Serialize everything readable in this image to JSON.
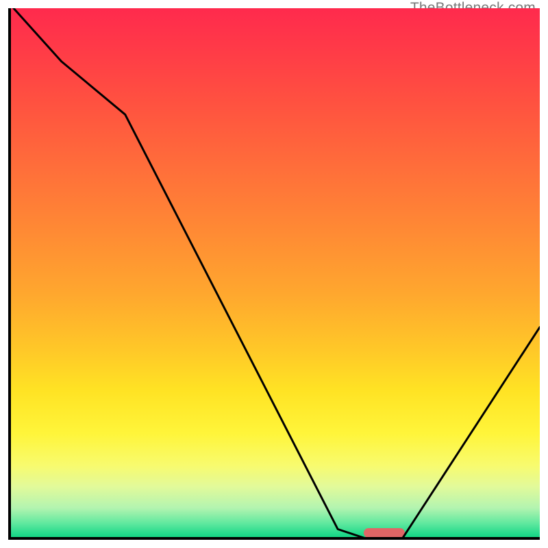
{
  "attribution": "TheBottleneck.com",
  "chart_data": {
    "type": "line",
    "title": "",
    "xlabel": "",
    "ylabel": "",
    "xlim": [
      0,
      100
    ],
    "ylim": [
      0,
      100
    ],
    "x": [
      1,
      10,
      22,
      62,
      68,
      74,
      100
    ],
    "values": [
      100,
      90,
      80,
      2,
      0,
      0,
      40
    ],
    "marker": {
      "x": 71,
      "y": 0,
      "width": 8,
      "color": "#e06666"
    },
    "background": "vertical rainbow gradient red→green",
    "axes": {
      "left": true,
      "bottom": true,
      "right": false,
      "top": false
    },
    "annotations": []
  }
}
